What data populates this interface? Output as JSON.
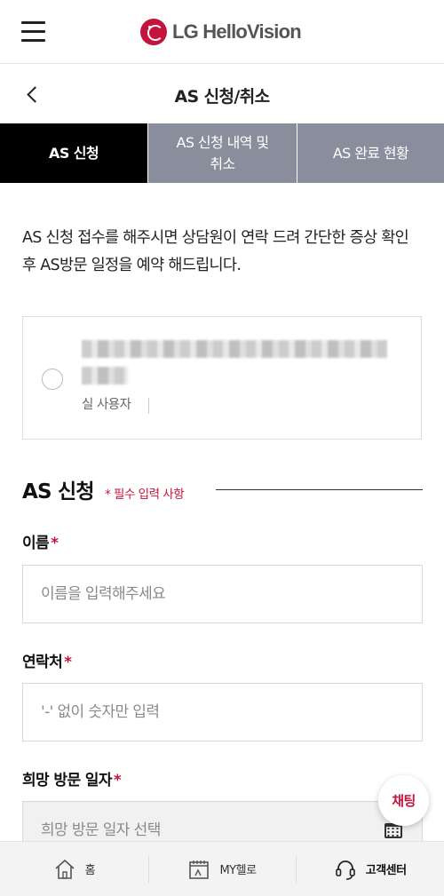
{
  "header": {
    "logo_text": "LG HelloVision",
    "menu_icon": "hamburger-menu-icon"
  },
  "page": {
    "title": "AS 신청/취소",
    "back_icon": "chevron-left-icon"
  },
  "tabs": [
    {
      "label": "AS 신청",
      "active": true
    },
    {
      "label": "AS 신청 내역 및\n취소",
      "active": false
    },
    {
      "label": "AS 완료 현황",
      "active": false
    }
  ],
  "intro": "AS 신청 접수를 해주시면 상담원이 연락 드려 간단한 증상 확인 후 AS방문 일정을 예약 해드립니다.",
  "user_card": {
    "role": "실 사용자",
    "selected": false
  },
  "form": {
    "section_title": "AS 신청",
    "required_note": "필수 입력 사항",
    "required_mark": "*",
    "fields": {
      "name": {
        "label": "이름",
        "placeholder": "이름을 입력해주세요"
      },
      "phone": {
        "label": "연락처",
        "placeholder": "'-' 없이 숫자만 입력"
      },
      "visit_date": {
        "label": "희망 방문 일자",
        "placeholder": "희망 방문 일자 선택",
        "icon": "calendar-icon"
      }
    }
  },
  "chat_button": {
    "label": "채팅"
  },
  "bottom_nav": [
    {
      "label": "홈",
      "icon": "home-icon",
      "active": false
    },
    {
      "label": "MY헬로",
      "icon": "my-page-icon",
      "active": false
    },
    {
      "label": "고객센터",
      "icon": "headset-icon",
      "active": true
    }
  ],
  "colors": {
    "brand": "#c4133d",
    "tab_active": "#000000",
    "tab_inactive": "#8a8d9c"
  }
}
